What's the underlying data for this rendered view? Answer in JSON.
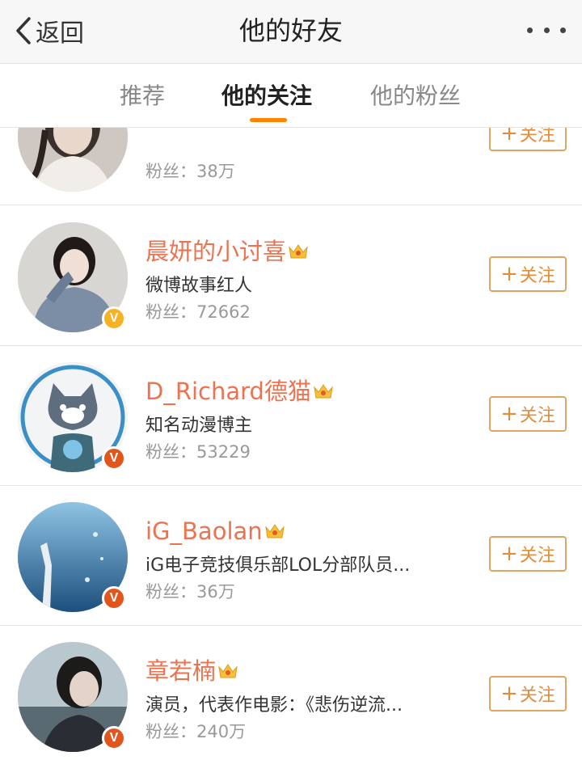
{
  "navbar": {
    "back_label": "返回",
    "title": "他的好友",
    "back_icon": "chevron-left-icon",
    "more_icon": "more-dots-icon"
  },
  "tabs": [
    {
      "label": "推荐",
      "active": false
    },
    {
      "label": "他的关注",
      "active": true
    },
    {
      "label": "他的粉丝",
      "active": false
    }
  ],
  "accent_color": "#ff8200",
  "name_color": "#eb7350",
  "follow_label": "关注",
  "fans_prefix": "粉丝：",
  "users": [
    {
      "name": "",
      "desc": "",
      "fans": "38万",
      "verified": "none",
      "crown": true
    },
    {
      "name": "晨妍的小讨喜",
      "desc": "微博故事红人",
      "fans": "72662",
      "verified": "gold",
      "crown": true
    },
    {
      "name": "D_Richard德猫",
      "desc": "知名动漫博主",
      "fans": "53229",
      "verified": "red",
      "crown": true
    },
    {
      "name": "iG_Baolan",
      "desc": "iG电子竞技俱乐部LOL分部队员...",
      "fans": "36万",
      "verified": "red",
      "crown": true
    },
    {
      "name": "章若楠",
      "desc": "演员，代表作电影：《悲伤逆流...",
      "fans": "240万",
      "verified": "red",
      "crown": true
    }
  ]
}
